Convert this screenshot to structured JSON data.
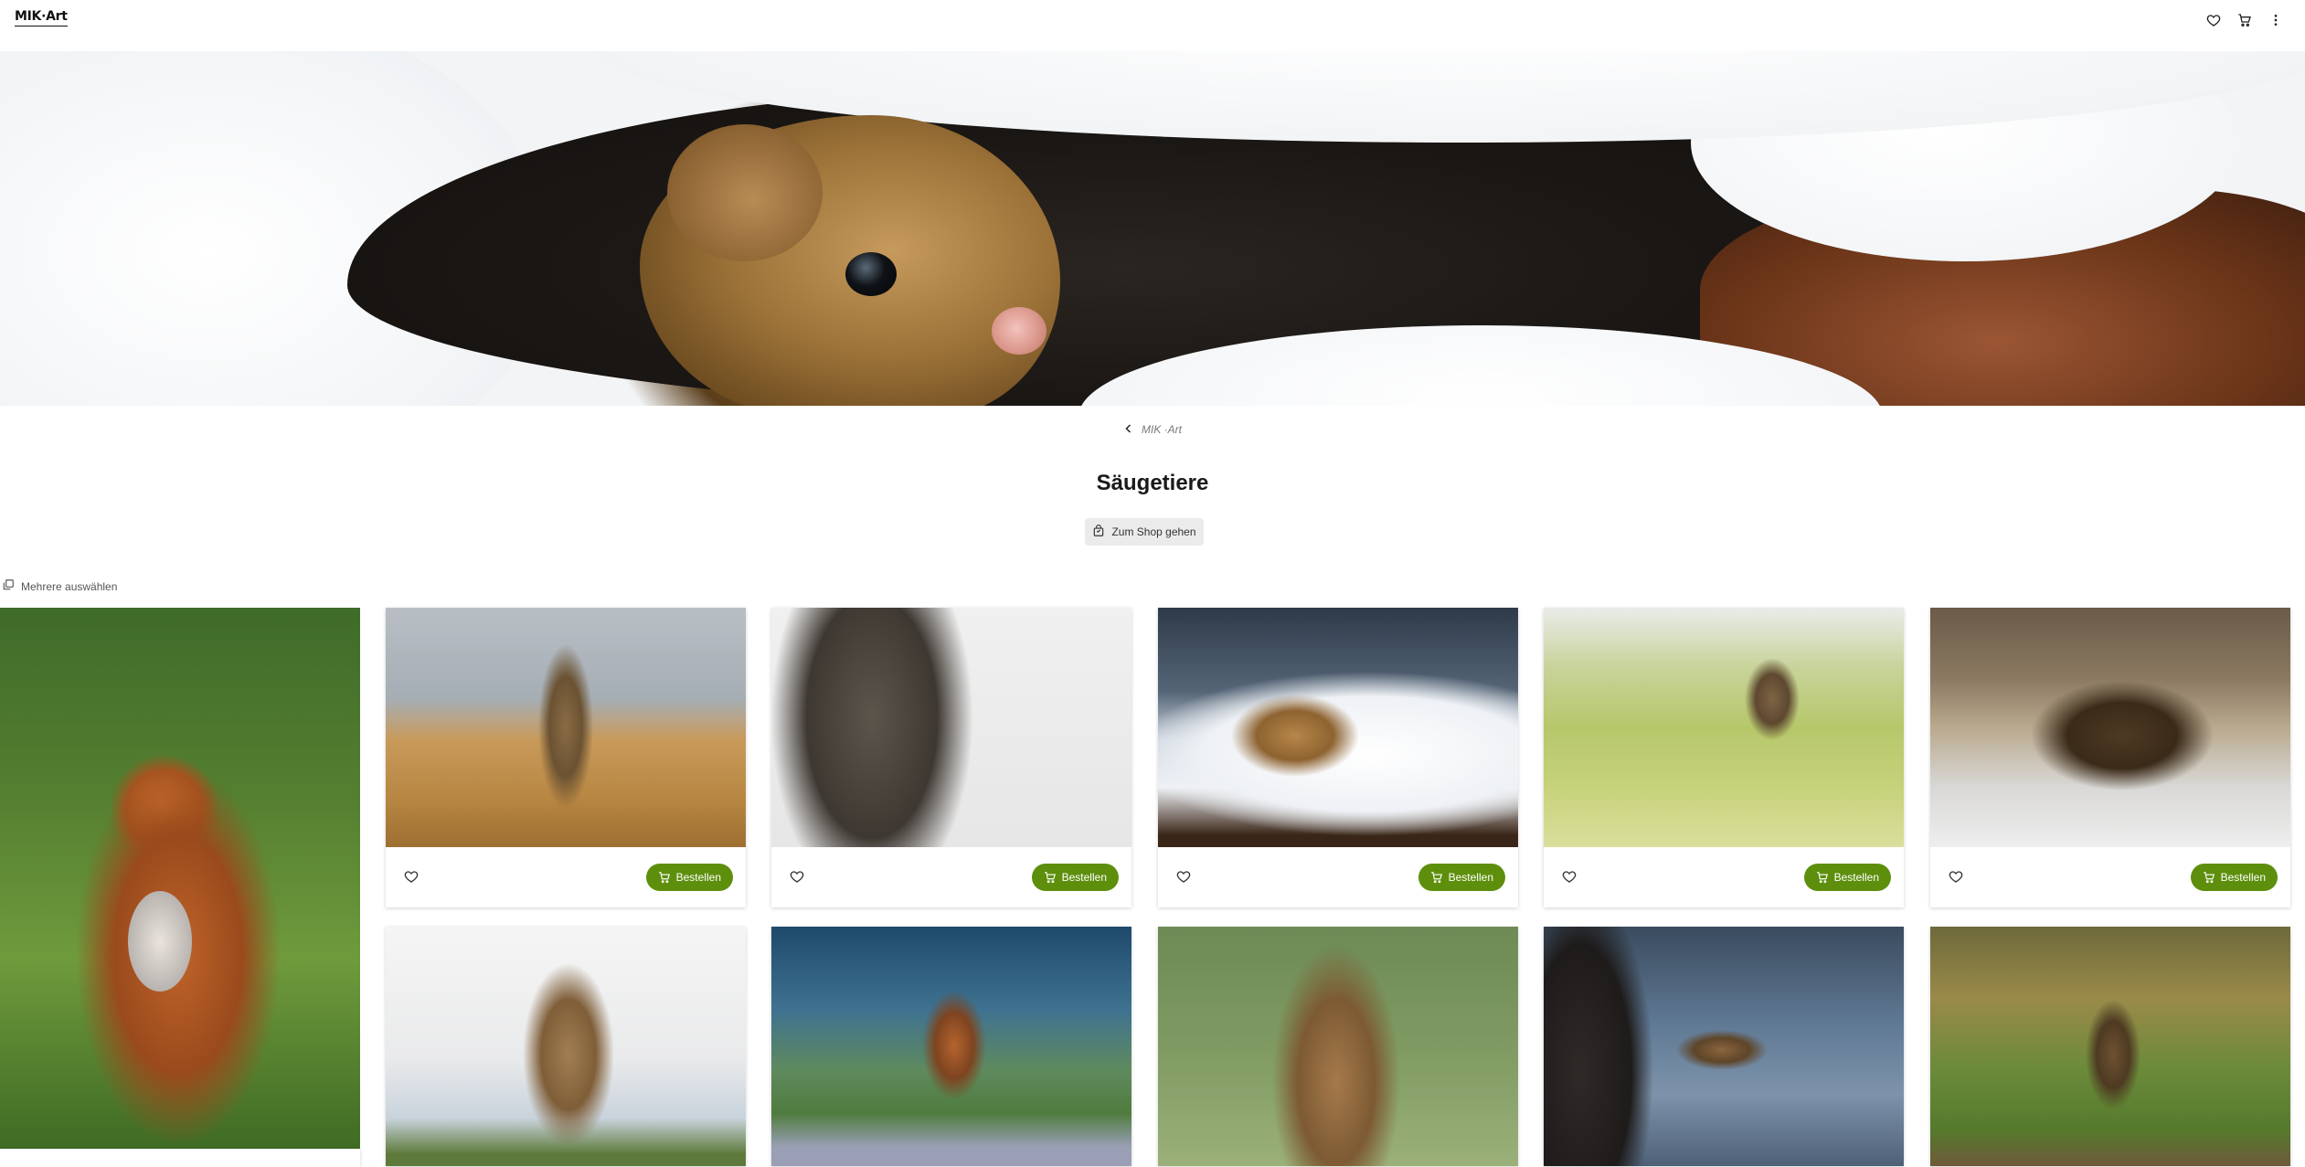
{
  "header": {
    "logo": "MIK·Art",
    "icons": [
      "heart-icon",
      "cart-icon",
      "more-vertical-icon"
    ]
  },
  "breadcrumb": {
    "label": "MIK ·Art"
  },
  "page": {
    "title": "Säugetiere"
  },
  "shop_button": {
    "label": "Zum Shop gehen"
  },
  "select_multiple": {
    "label": "Mehrere auswählen"
  },
  "grid": {
    "order_label": "Bestellen",
    "accent": "#5d8f0d"
  }
}
